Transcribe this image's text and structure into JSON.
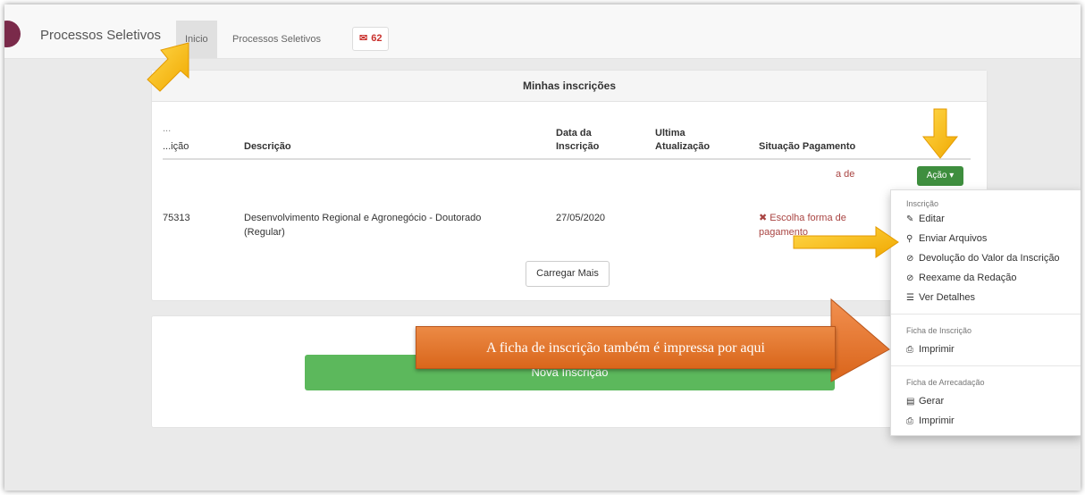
{
  "topbar": {
    "brand": "Processos Seletivos",
    "nav_inicio": "Inicio",
    "nav_processos": "Processos Seletivos",
    "mail_count": "62"
  },
  "inscricoes": {
    "title": "Minhas inscrições",
    "columns": {
      "inscricao_top": "...",
      "inscricao_bottom": "...ição",
      "descricao": "Descrição",
      "data_inscricao_1": "Data da",
      "data_inscricao_2": "Inscrição",
      "ultima_1": "Ultima",
      "ultima_2": "Atualização",
      "situacao": "Situação Pagamento"
    },
    "partial_row_text": "a de",
    "row": {
      "id": "75313",
      "descricao_1": "Desenvolvimento Regional e Agronegócio - Doutorado",
      "descricao_2": "(Regular)",
      "data": "27/05/2020",
      "situacao_1": "Escolha forma de",
      "situacao_2": "pagamento"
    },
    "acao_label": "Ação ▾",
    "carregar_mais": "Carregar Mais"
  },
  "nova_inscricao": "Nova Inscrição",
  "menu": {
    "header_inscricao": "Inscrição",
    "editar": "Editar",
    "enviar_arquivos": "Enviar Arquivos",
    "devolucao": "Devolução do Valor da Inscrição",
    "reexame": "Reexame da Redação",
    "ver_detalhes": "Ver Detalhes",
    "header_ficha": "Ficha de Inscrição",
    "imprimir_ficha": "Imprimir",
    "header_arrecadacao": "Ficha de Arrecadação",
    "gerar": "Gerar",
    "imprimir_arrecadacao": "Imprimir"
  },
  "callout": "A ficha de inscrição também é impressa por aqui",
  "colors": {
    "arrow": "#f5b800",
    "callout": "#e0732a",
    "acao": "#3e8e3e",
    "nova": "#5cb85c",
    "badge": "#c9302c"
  }
}
